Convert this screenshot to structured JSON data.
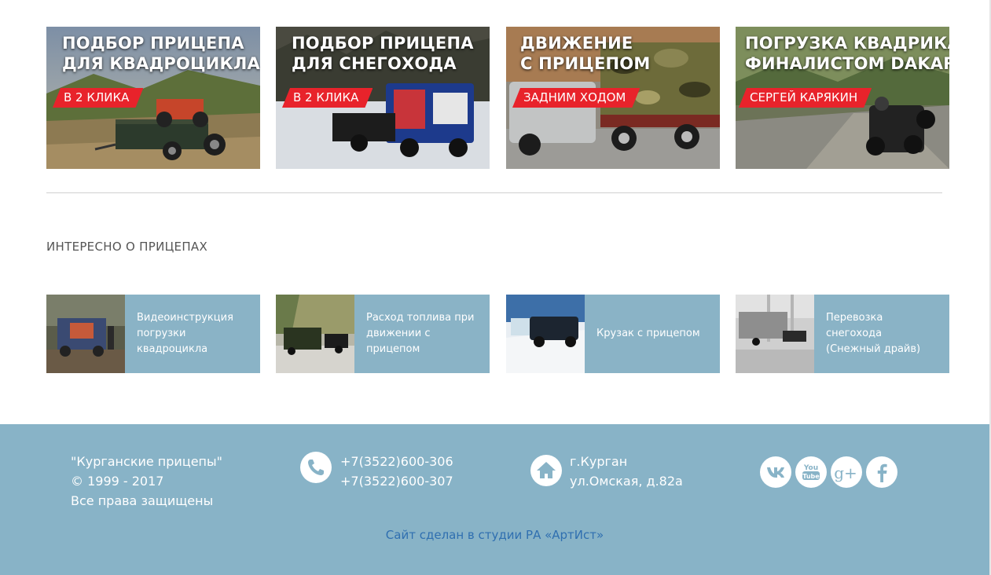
{
  "promos": [
    {
      "line1": "ПОДБОР ПРИЦЕПА",
      "line2": "ДЛЯ КВАДРОЦИКЛА",
      "tag": "В 2 КЛИКА"
    },
    {
      "line1": "ПОДБОР ПРИЦЕПА",
      "line2": "ДЛЯ СНЕГОХОДА",
      "tag": "В 2 КЛИКА"
    },
    {
      "line1": "ДВИЖЕНИЕ",
      "line2": "С ПРИЦЕПОМ",
      "tag": "ЗАДНИМ ХОДОМ"
    },
    {
      "line1": "ПОГРУЗКА КВАДРИКА",
      "line2": "ФИНАЛИСТОМ DAKAR",
      "tag": "СЕРГЕЙ КАРЯКИН"
    }
  ],
  "section_title": "ИНТЕРЕСНО О ПРИЦЕПАХ",
  "articles": [
    {
      "lines": [
        "Видеоинструкция",
        "погрузки",
        "квадроцикла"
      ]
    },
    {
      "lines": [
        "Расход топлива при",
        "движении с",
        "прицепом"
      ]
    },
    {
      "lines": [
        "Крузак с прицепом"
      ]
    },
    {
      "lines": [
        "Перевозка",
        "снегохода",
        "(Снежный драйв)"
      ]
    }
  ],
  "footer": {
    "company": "\"Курганские прицепы\"",
    "copyright": "© 1999 - 2017",
    "rights": "Все права защищены",
    "phone1": "+7(3522)600-306",
    "phone2": "+7(3522)600-307",
    "city": "г.Курган",
    "street": "ул.Омская, д.82а",
    "social": [
      "vk-icon",
      "youtube-icon",
      "google-plus-icon",
      "facebook-icon"
    ],
    "studio_link": "Сайт сделан в студии РА «АртИст»"
  },
  "colors": {
    "accent_red": "#e8232b",
    "panel_blue": "#88b3c7",
    "link_blue": "#2f6fb0"
  }
}
